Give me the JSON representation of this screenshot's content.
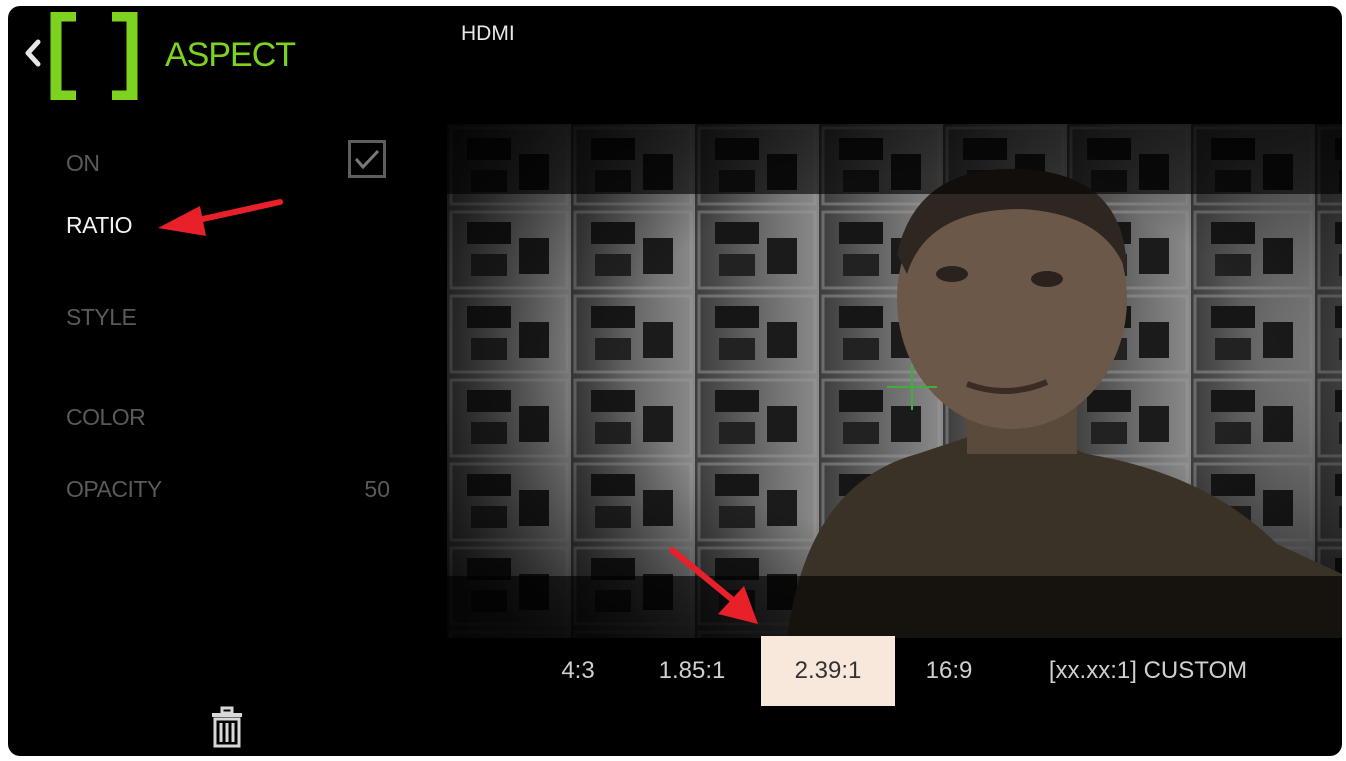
{
  "header": {
    "back_icon": "chevron-left-icon",
    "logo_icon": "bracket-frame-icon",
    "title": "ASPECT",
    "source": "HDMI"
  },
  "menu": {
    "items": [
      {
        "label": "ON",
        "active": false,
        "checked": true
      },
      {
        "label": "RATIO",
        "active": true
      },
      {
        "label": "STYLE",
        "active": false
      },
      {
        "label": "COLOR",
        "active": false
      },
      {
        "label": "OPACITY",
        "active": false,
        "value": "50"
      }
    ],
    "delete_icon": "trash-icon"
  },
  "ratio_bar": {
    "options": [
      {
        "label": "4:3",
        "selected": false
      },
      {
        "label": "1.85:1",
        "selected": false
      },
      {
        "label": "2.39:1",
        "selected": true
      },
      {
        "label": "16:9",
        "selected": false
      },
      {
        "label": "[xx.xx:1] CUSTOM",
        "selected": false
      }
    ]
  },
  "colors": {
    "accent": "#7ED321",
    "annotation_arrow": "#E8202A",
    "selected_bg": "#F8E8DC"
  }
}
